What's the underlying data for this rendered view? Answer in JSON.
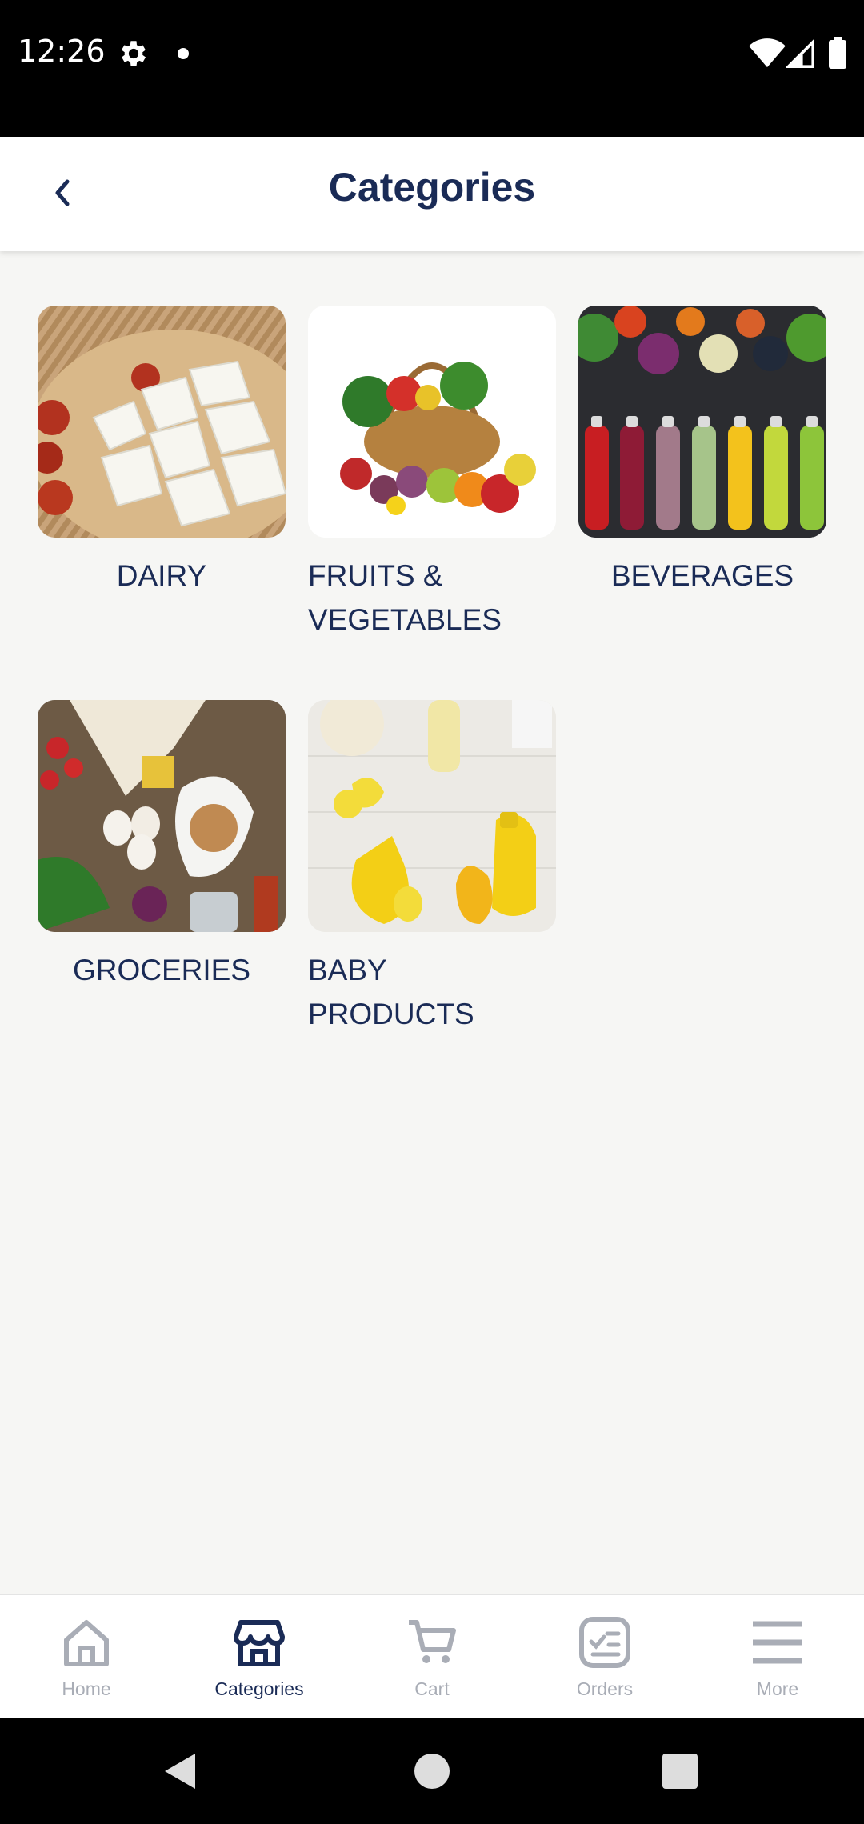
{
  "status_bar": {
    "time": "12:26"
  },
  "header": {
    "title": "Categories"
  },
  "categories": [
    {
      "label": "DAIRY"
    },
    {
      "label": "FRUITS &\nVEGETABLES"
    },
    {
      "label": "BEVERAGES"
    },
    {
      "label": "GROCERIES"
    },
    {
      "label": "BABY\nPRODUCTS"
    }
  ],
  "bottom_nav": {
    "items": [
      {
        "label": "Home",
        "icon": "home-icon"
      },
      {
        "label": "Categories",
        "icon": "store-icon"
      },
      {
        "label": "Cart",
        "icon": "cart-icon"
      },
      {
        "label": "Orders",
        "icon": "orders-icon"
      },
      {
        "label": "More",
        "icon": "menu-icon"
      }
    ],
    "active": "Categories"
  },
  "colors": {
    "primary": "#1a2b56",
    "inactive": "#a9adb6",
    "background": "#f6f6f4"
  }
}
